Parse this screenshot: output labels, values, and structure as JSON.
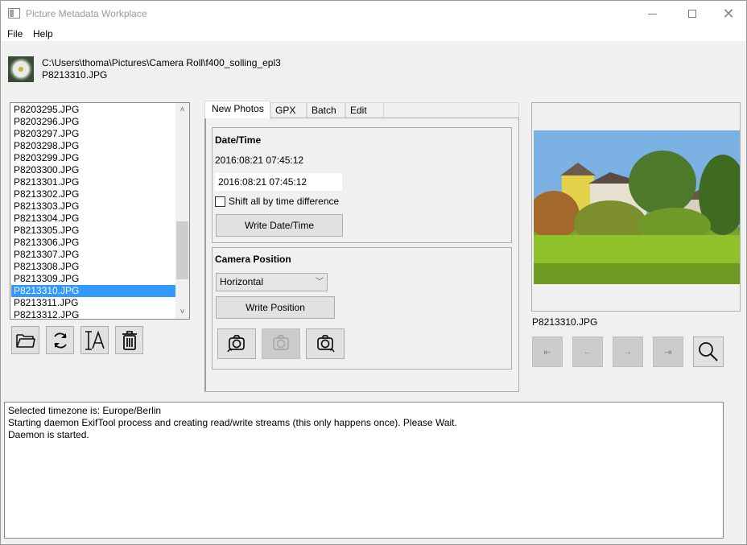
{
  "window": {
    "title": "Picture Metadata Workplace",
    "controls": {
      "minimize": "minimize",
      "maximize": "maximize",
      "close": "close"
    }
  },
  "menu": {
    "items": [
      "File",
      "Help"
    ]
  },
  "header": {
    "path": "C:\\Users\\thoma\\Pictures\\Camera Roll\\f400_solling_epl3",
    "filename": "P8213310.JPG"
  },
  "file_list": {
    "items": [
      "P8203295.JPG",
      "P8203296.JPG",
      "P8203297.JPG",
      "P8203298.JPG",
      "P8203299.JPG",
      "P8203300.JPG",
      "P8213301.JPG",
      "P8213302.JPG",
      "P8213303.JPG",
      "P8213304.JPG",
      "P8213305.JPG",
      "P8213306.JPG",
      "P8213307.JPG",
      "P8213308.JPG",
      "P8213309.JPG",
      "P8213310.JPG",
      "P8213311.JPG",
      "P8213312.JPG"
    ],
    "selected": "P8213310.JPG",
    "selection_color": "#3399ff"
  },
  "list_toolbar": {
    "buttons": [
      {
        "name": "open-folder",
        "icon": "folder-icon"
      },
      {
        "name": "refresh",
        "icon": "refresh-icon"
      },
      {
        "name": "rename",
        "icon": "rename-icon"
      },
      {
        "name": "delete",
        "icon": "trash-icon"
      }
    ]
  },
  "tabs": [
    {
      "label": "New Photos",
      "active": true
    },
    {
      "label": "GPX",
      "active": false
    },
    {
      "label": "Batch",
      "active": false
    },
    {
      "label": "Edit",
      "active": false
    }
  ],
  "datetime": {
    "title": "Date/Time",
    "current": "2016:08:21 07:45:12",
    "input_value": "2016:08:21 07:45:12",
    "shift_checkbox_label": "Shift all by time difference",
    "shift_checked": false,
    "write_button": "Write Date/Time"
  },
  "camera_position": {
    "title": "Camera Position",
    "selected_option": "Horizontal",
    "write_button": "Write Position",
    "rotate_buttons": [
      {
        "name": "rotate-left",
        "enabled": true
      },
      {
        "name": "rotate-none",
        "enabled": false
      },
      {
        "name": "rotate-right",
        "enabled": true
      }
    ]
  },
  "preview": {
    "caption": "P8213310.JPG",
    "nav_buttons": [
      {
        "name": "first",
        "glyph": "⇤",
        "enabled": false
      },
      {
        "name": "previous",
        "glyph": "←",
        "enabled": false
      },
      {
        "name": "next",
        "glyph": "→",
        "enabled": false
      },
      {
        "name": "last",
        "glyph": "⇥",
        "enabled": false
      }
    ],
    "zoom_button": "zoom"
  },
  "log": {
    "lines": [
      "Selected timezone is: Europe/Berlin",
      "Starting daemon ExifTool process and creating read/write streams (this only happens once). Please Wait.",
      "Daemon is started."
    ]
  }
}
